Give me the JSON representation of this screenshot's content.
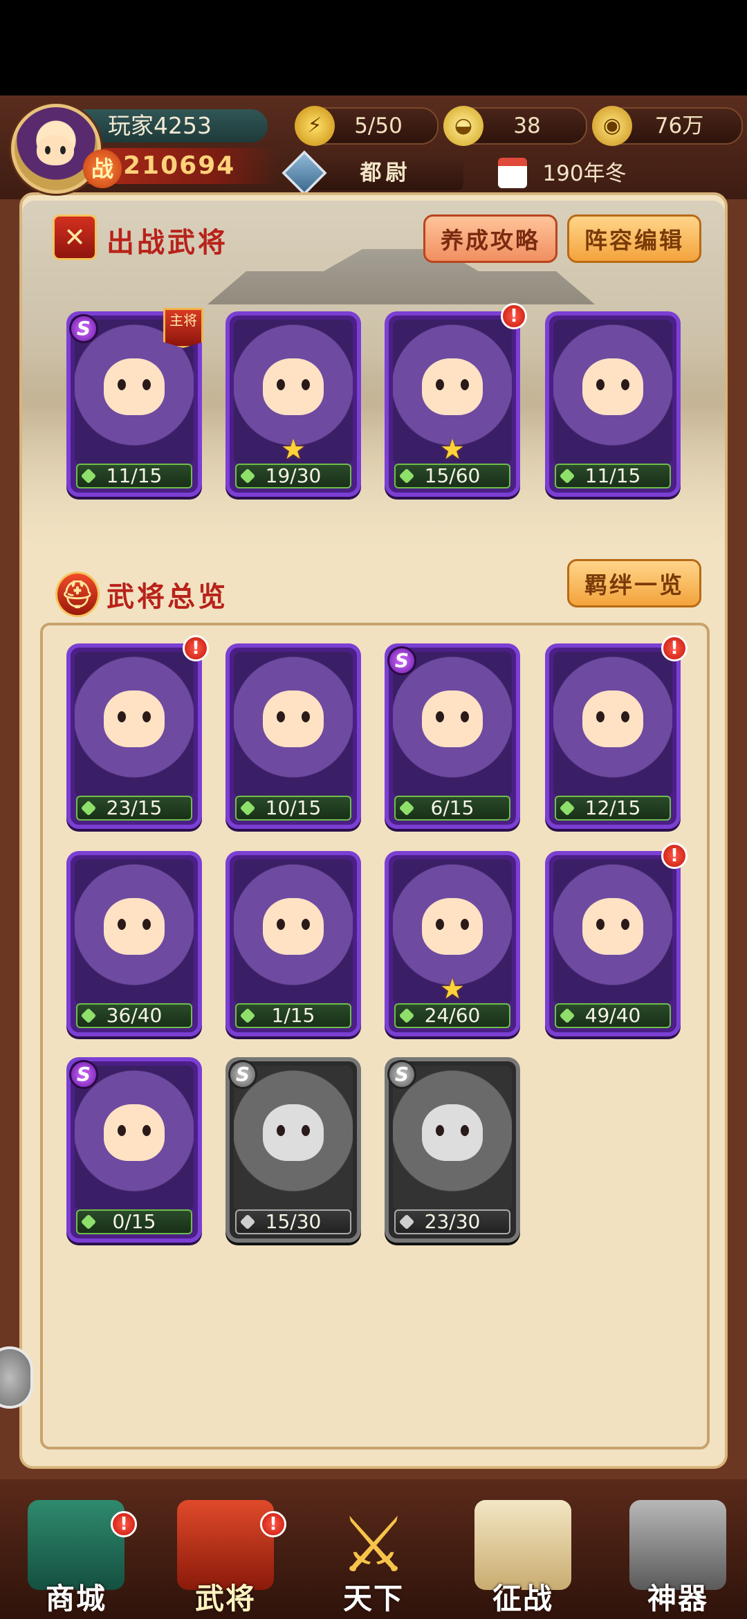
{
  "header": {
    "player_name": "玩家4253",
    "power_badge": "战",
    "power": "210694",
    "stamina": "5/50",
    "gold_ingot": "38",
    "coins": "76万",
    "rank": "都尉",
    "date": "190年冬"
  },
  "battle_section": {
    "title": "出战武将",
    "guide_button": "养成攻略",
    "formation_button": "阵容编辑",
    "leader_tag": "主将",
    "heroes": [
      {
        "fragments": "11/15",
        "s_rank": true,
        "leader": true,
        "star": false,
        "alert": false
      },
      {
        "fragments": "19/30",
        "s_rank": false,
        "leader": false,
        "star": true,
        "alert": false
      },
      {
        "fragments": "15/60",
        "s_rank": false,
        "leader": false,
        "star": true,
        "alert": true
      },
      {
        "fragments": "11/15",
        "s_rank": false,
        "leader": false,
        "star": false,
        "alert": false
      }
    ]
  },
  "overview_section": {
    "title": "武将总览",
    "bonds_button": "羁绊一览",
    "heroes": [
      {
        "fragments": "23/15",
        "s_rank": false,
        "alert": true,
        "star": false,
        "locked": false
      },
      {
        "fragments": "10/15",
        "s_rank": false,
        "alert": false,
        "star": false,
        "locked": false
      },
      {
        "fragments": "6/15",
        "s_rank": true,
        "alert": false,
        "star": false,
        "locked": false
      },
      {
        "fragments": "12/15",
        "s_rank": false,
        "alert": true,
        "star": false,
        "locked": false
      },
      {
        "fragments": "36/40",
        "s_rank": false,
        "alert": false,
        "star": false,
        "locked": false
      },
      {
        "fragments": "1/15",
        "s_rank": false,
        "alert": false,
        "star": false,
        "locked": false
      },
      {
        "fragments": "24/60",
        "s_rank": false,
        "alert": false,
        "star": true,
        "locked": false
      },
      {
        "fragments": "49/40",
        "s_rank": false,
        "alert": true,
        "star": false,
        "locked": false
      },
      {
        "fragments": "0/15",
        "s_rank": true,
        "alert": false,
        "star": false,
        "locked": false
      },
      {
        "fragments": "15/30",
        "s_rank": true,
        "alert": false,
        "star": false,
        "locked": true
      },
      {
        "fragments": "23/30",
        "s_rank": true,
        "alert": false,
        "star": false,
        "locked": true
      }
    ]
  },
  "badges": {
    "s": "S",
    "alert": "!",
    "star": "★"
  },
  "nav": [
    {
      "label": "商城",
      "icon": "shop-pagoda-icon",
      "alert": true,
      "active": false
    },
    {
      "label": "武将",
      "icon": "general-helmet-icon",
      "alert": true,
      "active": true
    },
    {
      "label": "天下",
      "icon": "crossed-swords-icon",
      "alert": false,
      "active": false
    },
    {
      "label": "征战",
      "icon": "battle-flag-icon",
      "alert": false,
      "active": false
    },
    {
      "label": "神器",
      "icon": "artifact-icon",
      "alert": false,
      "active": false
    }
  ],
  "colors": {
    "accent_red": "#b8221a",
    "card_purple": "#7b3fd3",
    "fragment_green": "#6fbf4a"
  }
}
